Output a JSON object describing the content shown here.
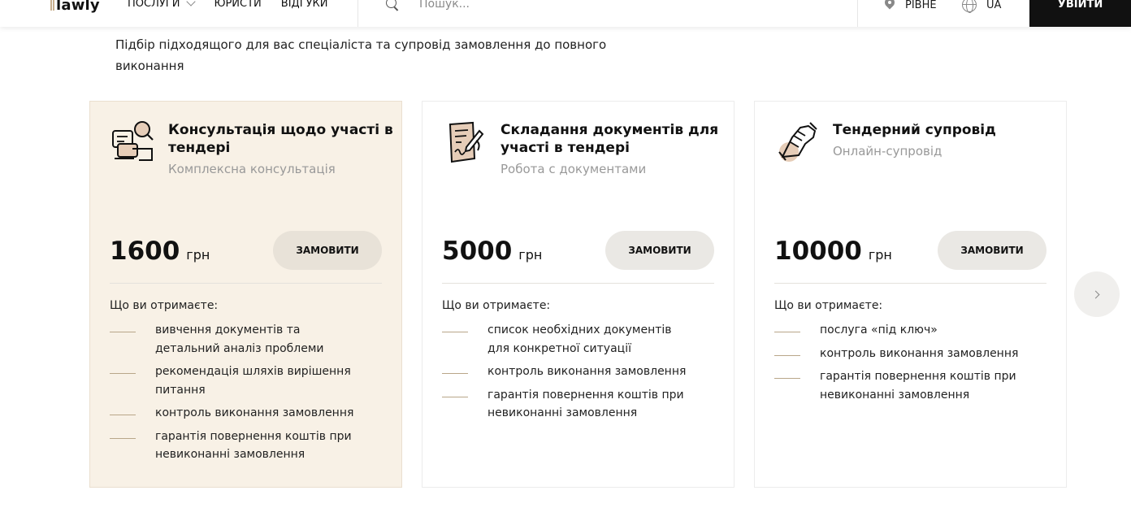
{
  "header": {
    "logo_text": "lawly",
    "nav": [
      {
        "label": "ПОСЛУГИ"
      },
      {
        "label": "ЮРИСТИ"
      },
      {
        "label": "ВІДГУКИ"
      }
    ],
    "search_placeholder": "Пошук...",
    "city": "РІВНЕ",
    "language": "UA",
    "login_label": "УВІЙТИ"
  },
  "intro_text": "Підбір підходящого для вас спеціаліста та супровід замовлення до повного виконання",
  "cards": [
    {
      "title": "Консультація щодо участі в тендері",
      "subtitle": "Комплексна консультація",
      "icon": "consultation-icon",
      "price": "1600",
      "currency": "грн",
      "order_label": "ЗАМОВИТИ",
      "get_label": "Що ви отримаєте:",
      "features": [
        "вивчення документів та детальний аналіз проблеми",
        "рекомендація шляхів вирішення питання",
        "контроль виконання замовлення",
        "гарантія повернення коштів при невиконанні замовлення"
      ]
    },
    {
      "title": "Складання документів для участі в тендері",
      "subtitle": "Робота с документами",
      "icon": "document-sign-icon",
      "price": "5000",
      "currency": "грн",
      "order_label": "ЗАМОВИТИ",
      "get_label": "Що ви отримаєте:",
      "features": [
        "список необхідних документів для конкретної ситуації",
        "контроль виконання замовлення",
        "гарантія повернення коштів при невиконанні замовлення"
      ]
    },
    {
      "title": "Тендерний супровід",
      "subtitle": "Онлайн-супровід",
      "icon": "handshake-icon",
      "price": "10000",
      "currency": "грн",
      "order_label": "ЗАМОВИТИ",
      "get_label": "Що ви отримаєте:",
      "features": [
        "послуга «під ключ»",
        "контроль виконання замовлення",
        "гарантія повернення коштів при невиконанні замовлення"
      ]
    }
  ],
  "colors": {
    "highlight_bg": "#f8f1e6",
    "accent": "#c9b08f",
    "dark": "#111111"
  }
}
